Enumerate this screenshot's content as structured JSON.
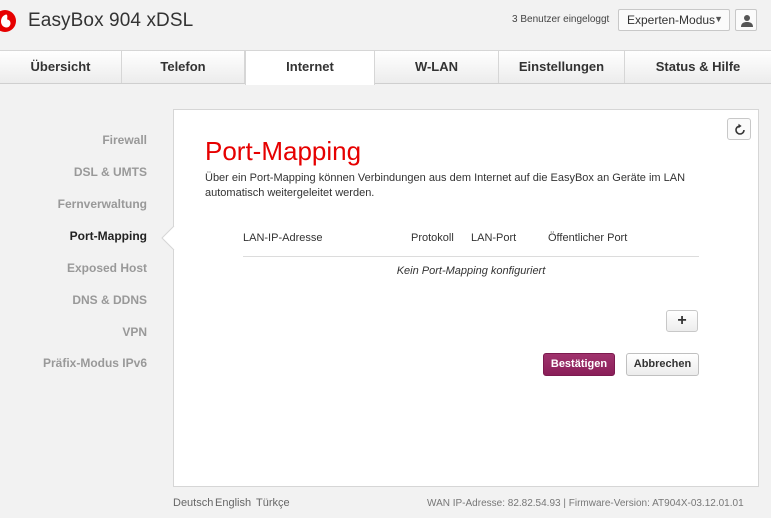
{
  "header": {
    "brand": "EasyBox 904 xDSL",
    "users_logged_in": "3 Benutzer eingeloggt",
    "mode": "Experten-Modus",
    "accent_color": "#e60000"
  },
  "nav": {
    "tabs": [
      {
        "label": "Übersicht"
      },
      {
        "label": "Telefon"
      },
      {
        "label": "Internet"
      },
      {
        "label": "W-LAN"
      },
      {
        "label": "Einstellungen"
      },
      {
        "label": "Status & Hilfe"
      }
    ],
    "active": "Internet"
  },
  "sidebar": {
    "items": [
      {
        "label": "Firewall"
      },
      {
        "label": "DSL & UMTS"
      },
      {
        "label": "Fernverwaltung"
      },
      {
        "label": "Port-Mapping"
      },
      {
        "label": "Exposed Host"
      },
      {
        "label": "DNS & DDNS"
      },
      {
        "label": "VPN"
      },
      {
        "label": "Präfix-Modus IPv6"
      }
    ],
    "active": "Port-Mapping"
  },
  "main": {
    "title": "Port-Mapping",
    "description": "Über ein Port-Mapping können Verbindungen aus dem Internet auf die EasyBox an Geräte im LAN automatisch weitergeleitet werden.",
    "table": {
      "columns": [
        "LAN-IP-Adresse",
        "Protokoll",
        "LAN-Port",
        "Öffentlicher Port"
      ],
      "rows": [],
      "empty_message": "Kein Port-Mapping konfiguriert"
    },
    "add_label": "+",
    "confirm_label": "Bestätigen",
    "cancel_label": "Abbrechen",
    "confirm_color": "#941f60"
  },
  "footer": {
    "languages": [
      "Deutsch",
      "English",
      "Türkçe"
    ],
    "info": "WAN IP-Adresse: 82.82.54.93 | Firmware-Version: AT904X-03.12.01.01"
  },
  "icons": {
    "logo": "vodafone-logo-icon",
    "user": "user-icon",
    "refresh": "refresh-icon",
    "caret": "caret-down-icon"
  }
}
